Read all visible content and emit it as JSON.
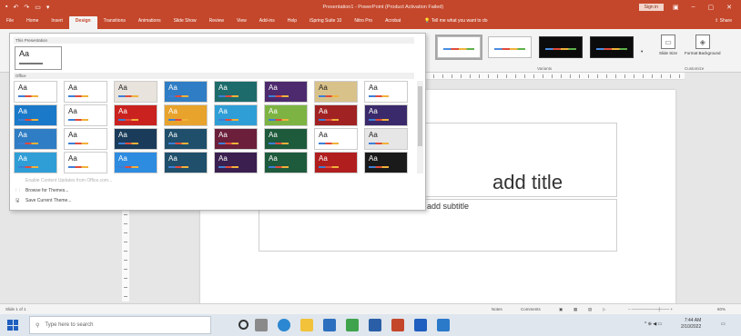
{
  "app": {
    "window_title": "Presentation1 - PowerPoint (Product Activation Failed)",
    "sign_in": "Sign in",
    "qat_icons": [
      "save-icon",
      "undo-icon",
      "redo-icon",
      "start-from-beginning-icon",
      "customize-icon"
    ]
  },
  "tabs": [
    {
      "label": "File"
    },
    {
      "label": "Home"
    },
    {
      "label": "Insert"
    },
    {
      "label": "Design",
      "active": true
    },
    {
      "label": "Transitions"
    },
    {
      "label": "Animations"
    },
    {
      "label": "Slide Show"
    },
    {
      "label": "Review"
    },
    {
      "label": "View"
    },
    {
      "label": "Add-ins"
    },
    {
      "label": "Help"
    },
    {
      "label": "iSpring Suite 10"
    },
    {
      "label": "Nitro Pro"
    },
    {
      "label": "Acrobat"
    }
  ],
  "tell_me": "Tell me what you want to do",
  "share": "Share",
  "ribbon": {
    "variants_label": "Variants",
    "customize_label": "Customize",
    "slide_size": "Slide Size",
    "format_background": "Format Background"
  },
  "themes": {
    "this_presentation_label": "This Presentation",
    "office_label": "Office",
    "aa": "Aa",
    "menu": {
      "enable_updates": "Enable Content Updates from Office.com...",
      "browse": "Browse for Themes...",
      "save": "Save Current Theme..."
    },
    "colors": [
      "#ffffff",
      "#ffffff",
      "#e8e3dc",
      "#2f7dc4",
      "#1e6b6b",
      "#4d2a6e",
      "#d9c28a",
      "#ffffff",
      "#1a79c9",
      "#ffffff",
      "#c9221f",
      "#e8a32c",
      "#2f9ed6",
      "#7cb342",
      "#a12222",
      "#3a2a6b",
      "#2f7dc4",
      "#ffffff",
      "#1a3c5a",
      "#1f4f6b",
      "#6b1f3a",
      "#1e5a3c",
      "#ffffff",
      "#e6e6e6",
      "#2f9ed6",
      "#ffffff",
      "#2d8be0",
      "#1f4f6b",
      "#3a1f4f",
      "#1e5a3c",
      "#b01e1e",
      "#1a1a1a"
    ]
  },
  "slide": {
    "title_placeholder": "add title",
    "subtitle_placeholder": "add subtitle"
  },
  "status": {
    "slide_info": "Slide 1 of 1",
    "notes": "Notes",
    "comments": "Comments",
    "zoom": "60%"
  },
  "taskbar": {
    "search_placeholder": "Type here to search",
    "time": "7:44 AM",
    "date": "2/10/2022"
  }
}
